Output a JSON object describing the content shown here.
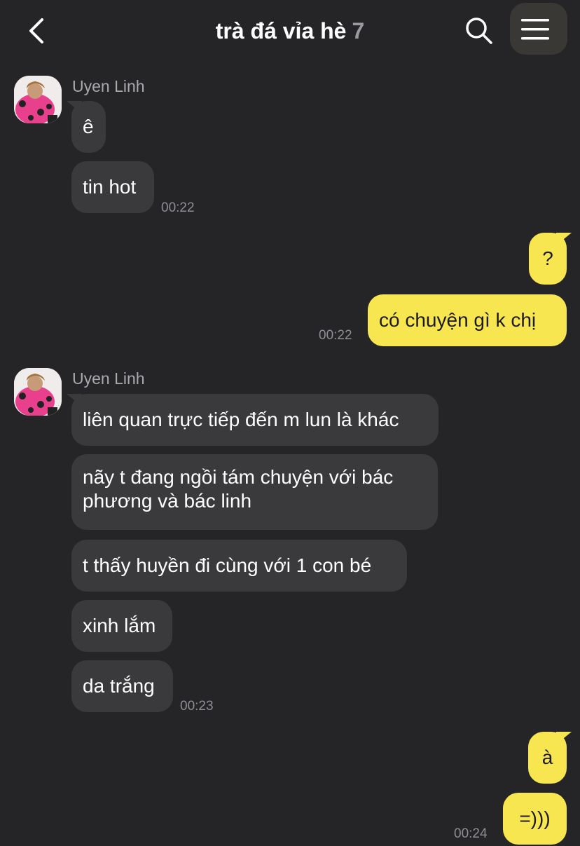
{
  "header": {
    "title": "trà đá vỉa hè",
    "member_count": "7",
    "back_icon": "chevron-left-icon",
    "search_icon": "search-icon",
    "menu_icon": "hamburger-menu-icon",
    "menu_badge_bg": "#3a3834"
  },
  "colors": {
    "background": "#252527",
    "incoming_bubble": "#3a3a3c",
    "outgoing_bubble": "#f8e650",
    "timestamp": "#8e8e93"
  },
  "messages": [
    {
      "sender": "Uyen Linh",
      "text": "ê"
    },
    {
      "text": "tin hot",
      "time": "00:22"
    },
    {
      "text": "?"
    },
    {
      "text": "có chuyện gì k chị",
      "time": "00:22"
    },
    {
      "sender": "Uyen Linh",
      "text": "liên quan trực tiếp đến m lun là khác"
    },
    {
      "text": "nãy t đang ngồi tám chuyện với bác phương và bác linh"
    },
    {
      "text": "t thấy huyền đi cùng với 1 con bé"
    },
    {
      "text": "xinh lắm"
    },
    {
      "text": "da trắng",
      "time": "00:23"
    },
    {
      "text": "à"
    },
    {
      "text": "=)))",
      "time": "00:24"
    }
  ]
}
